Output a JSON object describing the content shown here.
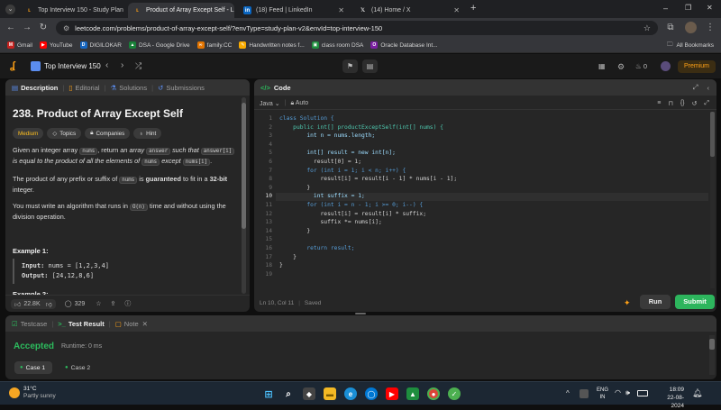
{
  "browser": {
    "tabs": [
      {
        "title": "Top Interview 150 - Study Plan",
        "active": false
      },
      {
        "title": "Product of Array Except Self - L",
        "active": true
      },
      {
        "title": "(18) Feed | LinkedIn",
        "active": false
      },
      {
        "title": "(14) Home / X",
        "active": false
      }
    ],
    "new_tab": "+",
    "url": "leetcode.com/problems/product-of-array-except-self/?envType=study-plan-v2&envId=top-interview-150",
    "bookmarks": [
      "Gmail",
      "YouTube",
      "DIGILOKAR",
      "DSA - Google Drive",
      "family.CC",
      "Handwritten notes f...",
      "class room DSA",
      "Oracle Database Int..."
    ],
    "all_bookmarks": "All Bookmarks",
    "window_controls": {
      "minimize": "–",
      "maximize": "❐",
      "close": "✕"
    }
  },
  "header": {
    "study_plan_title": "Top Interview 150",
    "premium_label": "Premium",
    "streak_count": "0"
  },
  "description": {
    "tabs": [
      "Description",
      "Editorial",
      "Solutions",
      "Submissions"
    ],
    "title": "238. Product of Array Except Self",
    "difficulty": "Medium",
    "tags": [
      "Topics",
      "Companies",
      "Hint"
    ],
    "p1_a": "Given an integer array ",
    "p1_code1": "nums",
    "p1_b": ", return ",
    "p1_c": "an array",
    "p1_code2": "answer",
    "p1_d": " such that ",
    "p1_code3": "answer[i]",
    "p1_e": "is equal to the product of all the elements of",
    "p1_code4": "nums",
    "p1_f": " except ",
    "p1_code5": "nums[i]",
    "p1_g": ".",
    "p2_a": "The product of any prefix or suffix of ",
    "p2_code": "nums",
    "p2_b": " is ",
    "p2_c": "guaranteed",
    "p2_d": " to fit in a ",
    "p2_e": "32-bit",
    "p2_f": "integer.",
    "p3_a": "You must write an algorithm that runs in ",
    "p3_code": "O(n)",
    "p3_b": " time and without using the",
    "p3_c": "division operation.",
    "example1_title": "Example 1:",
    "example1_input_label": "Input:",
    "example1_input": " nums = [1,2,3,4]",
    "example1_output_label": "Output:",
    "example1_output": " [24,12,8,6]",
    "example2_title": "Example 2:",
    "likes": "22.8K",
    "comments": "329"
  },
  "code_panel": {
    "title": "Code",
    "language": "Java",
    "mode": "Auto",
    "lines": [
      "class Solution {",
      "    public int[] productExceptSelf(int[] nums) {",
      "        int n = nums.length;",
      "",
      "        int[] result = new int[n];",
      "          result[0] = 1;",
      "        for (int i = 1; i < n; i++) {",
      "            result[i] = result[i - 1] * nums[i - 1];",
      "        }",
      "          int suffix = 1;",
      "        for (int i = n - 1; i >= 0; i--) {",
      "            result[i] = result[i] * suffix;",
      "            suffix *= nums[i];",
      "        }",
      "",
      "        return result;",
      "    }",
      "}",
      ""
    ],
    "line_numbers": [
      "1",
      "2",
      "3",
      "4",
      "5",
      "6",
      "7",
      "8",
      "9",
      "10",
      "11",
      "12",
      "13",
      "14",
      "15",
      "16",
      "17",
      "18",
      "19"
    ],
    "status": "Ln 10, Col 11",
    "saved": "Saved",
    "run_label": "Run",
    "submit_label": "Submit"
  },
  "result_panel": {
    "tabs": [
      "Testcase",
      "Test Result",
      "Note"
    ],
    "status": "Accepted",
    "runtime": "Runtime: 0 ms",
    "cases": [
      "Case 1",
      "Case 2"
    ]
  },
  "taskbar": {
    "weather_temp": "31°C",
    "weather_desc": "Partly sunny",
    "lang": "ENG",
    "region": "IN",
    "time": "18:09",
    "date": "22-08-2024"
  },
  "colors": {
    "accent_orange": "#ffa116",
    "accepted_green": "#2cbb5d",
    "submit_green": "#2db55d",
    "medium_yellow": "#ffc01e"
  }
}
